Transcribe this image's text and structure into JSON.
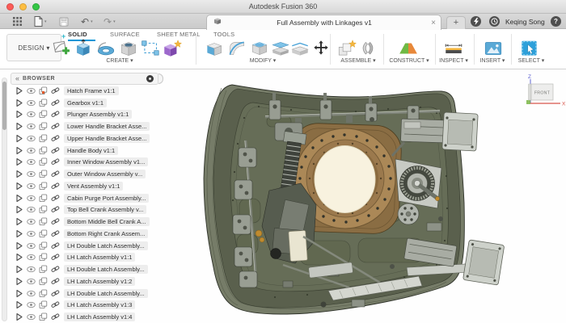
{
  "window": {
    "title": "Autodesk Fusion 360"
  },
  "tabbar": {
    "document_tab": {
      "title": "Full Assembly with Linkages v1",
      "close_label": "×"
    },
    "new_tab_label": "+",
    "user_name": "Keqing Song",
    "help_label": "?"
  },
  "toolbar": {
    "workspace_label": "DESIGN ▾",
    "tabs": [
      {
        "label": "SOLID",
        "active": true
      },
      {
        "label": "SURFACE",
        "active": false
      },
      {
        "label": "SHEET METAL",
        "active": false
      },
      {
        "label": "TOOLS",
        "active": false
      }
    ],
    "groups": [
      "CREATE ▾",
      "MODIFY ▾",
      "ASSEMBLE ▾",
      "CONSTRUCT ▾",
      "INSPECT ▾",
      "INSERT ▾",
      "SELECT ▾"
    ]
  },
  "browser": {
    "collapse_label": "«",
    "title": "BROWSER",
    "items": [
      {
        "label": "Hatch Frame v1:1",
        "modified": true
      },
      {
        "label": "Gearbox v1:1"
      },
      {
        "label": "Plunger Assembly v1:1"
      },
      {
        "label": "Lower Handle Bracket Asse..."
      },
      {
        "label": "Upper Handle Bracket Asse..."
      },
      {
        "label": "Handle Body v1:1"
      },
      {
        "label": "Inner Window Assembly v1..."
      },
      {
        "label": "Outer Window Assembly v..."
      },
      {
        "label": "Vent Assembly v1:1"
      },
      {
        "label": "Cabin Purge Port Assembly..."
      },
      {
        "label": "Top Bell Crank Assembly v..."
      },
      {
        "label": "Bottom Middle Bell Crank A..."
      },
      {
        "label": "Bottom Right Crank Assem..."
      },
      {
        "label": "LH Double Latch Assembly..."
      },
      {
        "label": "LH Latch Assembly v1:1"
      },
      {
        "label": "LH Double Latch Assembly..."
      },
      {
        "label": "LH Latch Assembly v1:2"
      },
      {
        "label": "LH Double Latch Assembly..."
      },
      {
        "label": "LH Latch Assembly v1:3"
      },
      {
        "label": "LH Latch Assembly v1:4"
      }
    ]
  },
  "viewcube": {
    "face_label": "FRONT",
    "axis_x": "X",
    "axis_z": "Z"
  },
  "colors": {
    "accent_blue": "#0696d7",
    "hatch_olive": "#5a604d",
    "panel_olive": "#666d57",
    "flange_bronze": "#ab8857",
    "window_cream": "#f8f2df",
    "traffic_red": "#fc5b57",
    "traffic_yellow": "#fdbe41",
    "traffic_green": "#33c644"
  }
}
